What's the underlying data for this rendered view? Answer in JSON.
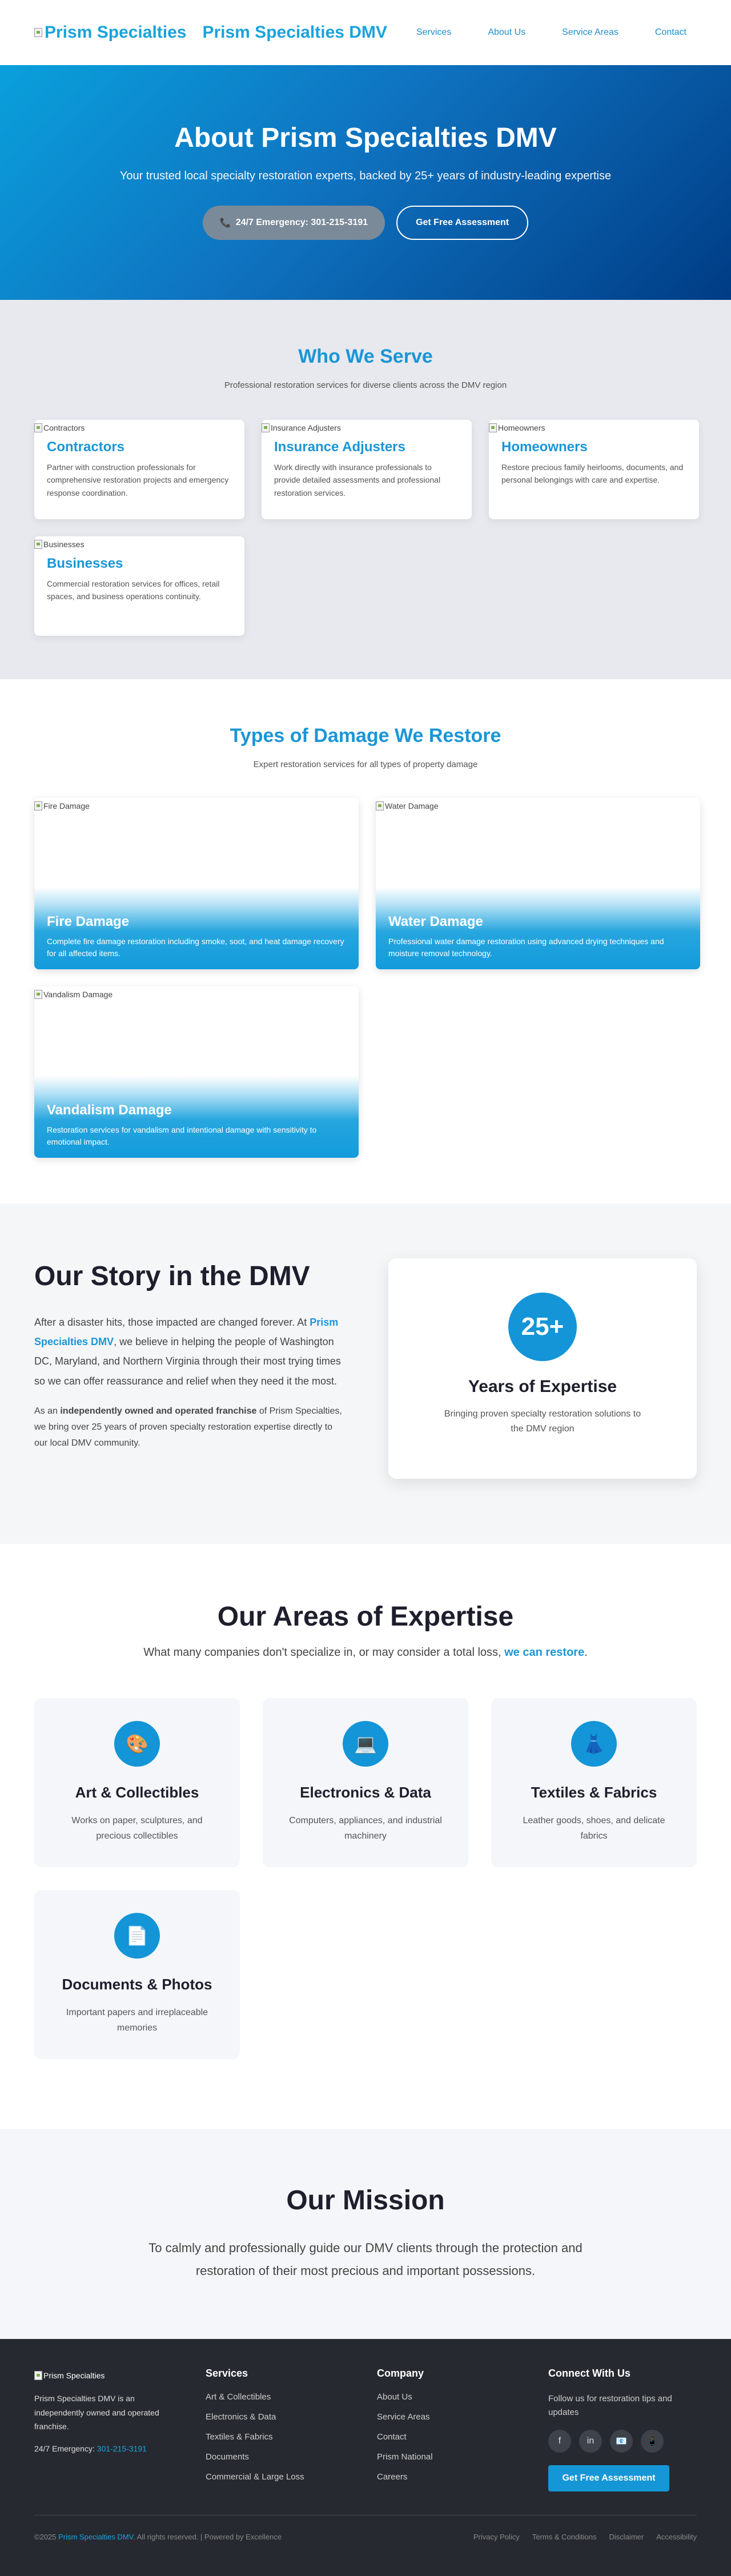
{
  "nav": {
    "logo_alt": "Prism Specialties",
    "brand": "Prism Specialties DMV",
    "links": [
      "Services",
      "About Us",
      "Service Areas",
      "Contact"
    ]
  },
  "hero": {
    "title": "About Prism Specialties DMV",
    "subtitle": "Your trusted local specialty restoration experts, backed by 25+ years of industry-leading expertise",
    "emergency_btn": "24/7 Emergency: 301-215-3191",
    "assessment_btn": "Get Free Assessment"
  },
  "serve": {
    "title": "Who We Serve",
    "subtitle": "Professional restoration services for diverse clients across the DMV region",
    "cards": [
      {
        "img_alt": "Contractors",
        "title": "Contractors",
        "text": "Partner with construction professionals for comprehensive restoration projects and emergency response coordination."
      },
      {
        "img_alt": "Insurance Adjusters",
        "title": "Insurance Adjusters",
        "text": "Work directly with insurance professionals to provide detailed assessments and professional restoration services."
      },
      {
        "img_alt": "Homeowners",
        "title": "Homeowners",
        "text": "Restore precious family heirlooms, documents, and personal belongings with care and expertise."
      },
      {
        "img_alt": "Businesses",
        "title": "Businesses",
        "text": "Commercial restoration services for offices, retail spaces, and business operations continuity."
      }
    ]
  },
  "damage": {
    "title": "Types of Damage We Restore",
    "subtitle": "Expert restoration services for all types of property damage",
    "cards": [
      {
        "img_alt": "Fire Damage",
        "title": "Fire Damage",
        "text": "Complete fire damage restoration including smoke, soot, and heat damage recovery for all affected items."
      },
      {
        "img_alt": "Water Damage",
        "title": "Water Damage",
        "text": "Professional water damage restoration using advanced drying techniques and moisture removal technology."
      },
      {
        "img_alt": "Vandalism Damage",
        "title": "Vandalism Damage",
        "text": "Restoration services for vandalism and intentional damage with sensitivity to emotional impact."
      }
    ]
  },
  "story": {
    "title": "Our Story in the DMV",
    "p1_before": "After a disaster hits, those impacted are changed forever. At ",
    "p1_highlight": "Prism Specialties DMV",
    "p1_after": ", we believe in helping the people of Washington DC, Maryland, and Northern Virginia through their most trying times so we can offer reassurance and relief when they need it the most.",
    "p2_before": "As an ",
    "p2_bold": "independently owned and operated franchise",
    "p2_after": " of Prism Specialties, we bring over 25 years of proven specialty restoration expertise directly to our local DMV community.",
    "badge": "25+",
    "card_title": "Years of Expertise",
    "card_text": "Bringing proven specialty restoration solutions to the DMV region"
  },
  "expertise": {
    "title": "Our Areas of Expertise",
    "subtitle_before": "What many companies don't specialize in, or may consider a total loss, ",
    "subtitle_highlight": "we can restore",
    "subtitle_after": ".",
    "cards": [
      {
        "icon": "🎨",
        "icon_name": "palette-icon",
        "title": "Art & Collectibles",
        "text": "Works on paper, sculptures, and precious collectibles"
      },
      {
        "icon": "💻",
        "icon_name": "laptop-icon",
        "title": "Electronics & Data",
        "text": "Computers, appliances, and industrial machinery"
      },
      {
        "icon": "👗",
        "icon_name": "dress-icon",
        "title": "Textiles & Fabrics",
        "text": "Leather goods, shoes, and delicate fabrics"
      },
      {
        "icon": "📄",
        "icon_name": "document-icon",
        "title": "Documents & Photos",
        "text": "Important papers and irreplaceable memories"
      }
    ]
  },
  "mission": {
    "title": "Our Mission",
    "text": "To calmly and professionally guide our DMV clients through the protection and restoration of their most precious and important possessions."
  },
  "footer": {
    "logo_alt": "Prism Specialties",
    "about": "Prism Specialties DMV is an independently owned and operated franchise.",
    "phone_label": "24/7 Emergency: ",
    "phone": "301-215-3191",
    "services_title": "Services",
    "services": [
      "Art & Collectibles",
      "Electronics & Data",
      "Textiles & Fabrics",
      "Documents",
      "Commercial & Large Loss"
    ],
    "company_title": "Company",
    "company": [
      "About Us",
      "Service Areas",
      "Contact",
      "Prism National",
      "Careers"
    ],
    "connect_title": "Connect With Us",
    "connect_text": "Follow us for restoration tips and updates",
    "socials": [
      {
        "glyph": "f",
        "name": "facebook-icon"
      },
      {
        "glyph": "in",
        "name": "linkedin-icon"
      },
      {
        "glyph": "📧",
        "name": "email-icon"
      },
      {
        "glyph": "📱",
        "name": "phone-icon"
      }
    ],
    "cta": "Get Free Assessment",
    "copyright_before": "©2025 ",
    "copyright_brand": "Prism Specialties DMV",
    "copyright_after": ". All rights reserved. | Powered by Excellence",
    "legal": [
      "Privacy Policy",
      "Terms & Conditions",
      "Disclaimer",
      "Accessibility"
    ]
  },
  "colors": {
    "accent": "#1a96d6",
    "hero_start": "#0aa0dc",
    "hero_end": "#003c85",
    "footer_bg": "#262a30",
    "emergency_btn": "#7a8a99"
  }
}
